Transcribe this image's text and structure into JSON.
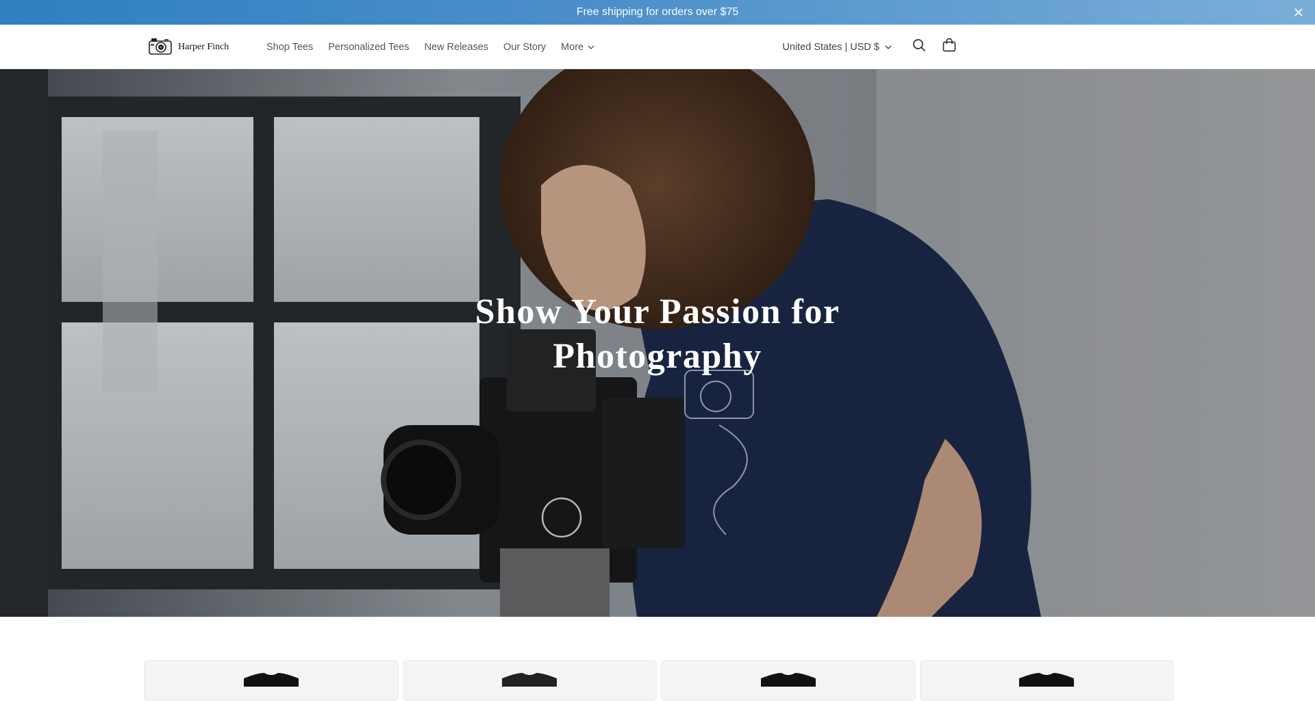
{
  "announcement": {
    "text": "Free shipping for orders over $75",
    "close_icon": "close-icon"
  },
  "header": {
    "brand": "Harper Finch",
    "logo_icon": "camera-icon",
    "nav": [
      {
        "label": "Shop Tees"
      },
      {
        "label": "Personalized Tees"
      },
      {
        "label": "New Releases"
      },
      {
        "label": "Our Story"
      },
      {
        "label": "More",
        "has_dropdown": true
      }
    ],
    "locale": "United States | USD $",
    "search_icon": "search-icon",
    "cart_icon": "cart-icon"
  },
  "hero": {
    "title_line1": "Show Your Passion for",
    "title_line2": "Photography"
  },
  "products": {
    "count_visible": 4,
    "item_icon": "t-shirt-icon"
  },
  "colors": {
    "announce_start": "#2f7fc1",
    "announce_end": "#7aaed9",
    "shirt_navy": "#1d2b4a"
  }
}
